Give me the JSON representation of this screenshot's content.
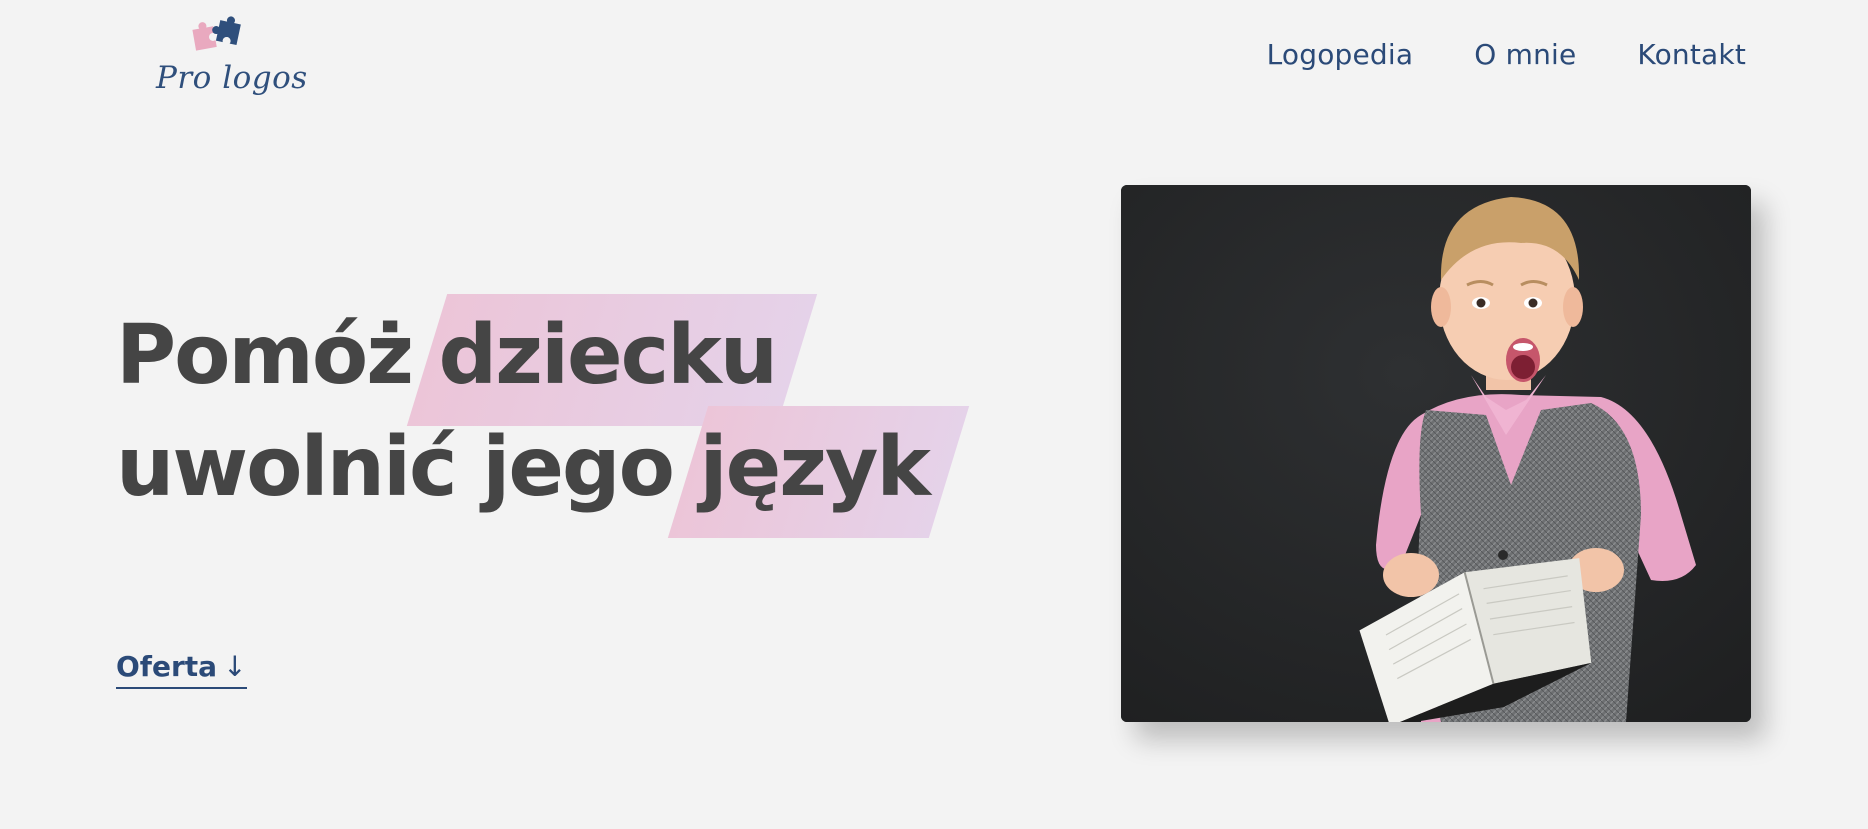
{
  "header": {
    "logo_text": "Pro logos",
    "nav": [
      {
        "label": "Logopedia"
      },
      {
        "label": "O mnie"
      },
      {
        "label": "Kontakt"
      }
    ]
  },
  "hero": {
    "headline": {
      "line1_plain": "Pomóż",
      "line1_highlight": "dziecku",
      "line2_plain": "uwolnić jego",
      "line2_highlight": "język"
    },
    "cta_label": "Oferta",
    "cta_arrow": "↓"
  },
  "photo": {
    "subject": "surprised boy holding an open book"
  },
  "colors": {
    "background": "#f3f3f3",
    "heading_text": "#454545",
    "brand_blue": "#2b4a78",
    "highlight_pink": "#ecc5d8",
    "highlight_lilac": "#e5d2e9",
    "puzzle_pink": "#e9a9bf",
    "puzzle_blue": "#2f4f7c"
  }
}
